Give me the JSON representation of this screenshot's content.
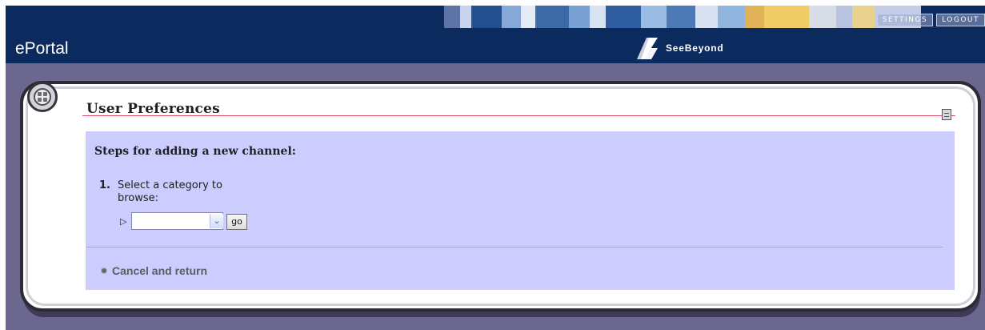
{
  "header": {
    "app_title": "ePortal",
    "brand_text": "SeeBeyond",
    "nav": {
      "settings_label": "SETTINGS",
      "logout_label": "LOGOUT"
    },
    "colors": {
      "header_bg": "#0b2a5e",
      "stripe_palette": [
        "#6a7fb0",
        "#b8c8e8",
        "#1f4d8e",
        "#7aa3d9",
        "#d6e0f2",
        "#4f7ab5",
        "#3d6ba8",
        "#95b8df",
        "#2f5e9c",
        "#c9d7ef",
        "#85add8",
        "#efc866",
        "#e2a342",
        "#d7dce7"
      ]
    }
  },
  "panel": {
    "title": "User Preferences",
    "steps_heading": "Steps for adding a new channel:",
    "step_1": {
      "number": "1.",
      "text": "Select a category to browse:",
      "select_value": "",
      "go_label": "go"
    },
    "cancel_label": "Cancel and return",
    "icons": {
      "channel_icon": "grid-circle-icon",
      "panel_options_icon": "panel-menu-icon",
      "play_icon": "play-icon",
      "bullet_icon": "bullet-icon",
      "chevron_icon": "chevron-down-icon"
    }
  }
}
